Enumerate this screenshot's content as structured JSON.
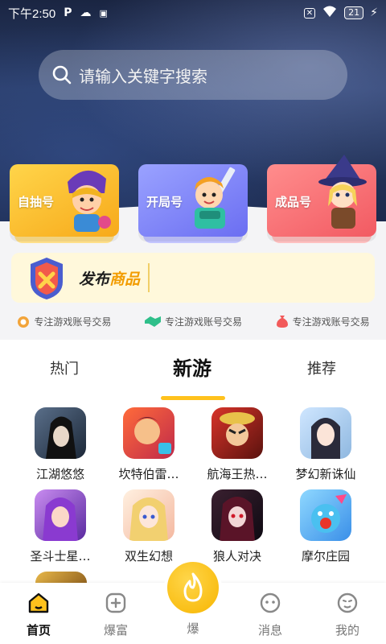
{
  "status_bar": {
    "time": "下午2:50",
    "battery": "21"
  },
  "search": {
    "placeholder": "请输入关键字搜索"
  },
  "categories": [
    {
      "label": "自抽号",
      "color": "#f7a91a"
    },
    {
      "label": "开局号",
      "color": "#6b6ef2"
    },
    {
      "label": "成品号",
      "color": "#f25a62"
    }
  ],
  "publish": {
    "label_a": "发布",
    "label_b": "商品"
  },
  "features": [
    {
      "text": "专注游戏账号交易",
      "icon": "medal-icon"
    },
    {
      "text": "专注游戏账号交易",
      "icon": "handshake-icon"
    },
    {
      "text": "专注游戏账号交易",
      "icon": "moneybag-icon"
    }
  ],
  "tabs": [
    {
      "label": "热门"
    },
    {
      "label": "新游",
      "active": true
    },
    {
      "label": "推荐"
    }
  ],
  "games": [
    {
      "name": "江湖悠悠"
    },
    {
      "name": "坎特伯雷…"
    },
    {
      "name": "航海王热…"
    },
    {
      "name": "梦幻新诛仙"
    },
    {
      "name": "圣斗士星…"
    },
    {
      "name": "双生幻想"
    },
    {
      "name": "狼人对决"
    },
    {
      "name": "摩尔庄园"
    }
  ],
  "nav": {
    "home": "首页",
    "baofu": "爆富",
    "bao": "爆",
    "messages": "消息",
    "mine": "我的"
  },
  "colors": {
    "accent": "#ffc21d",
    "hero": "#1c2a4d"
  }
}
